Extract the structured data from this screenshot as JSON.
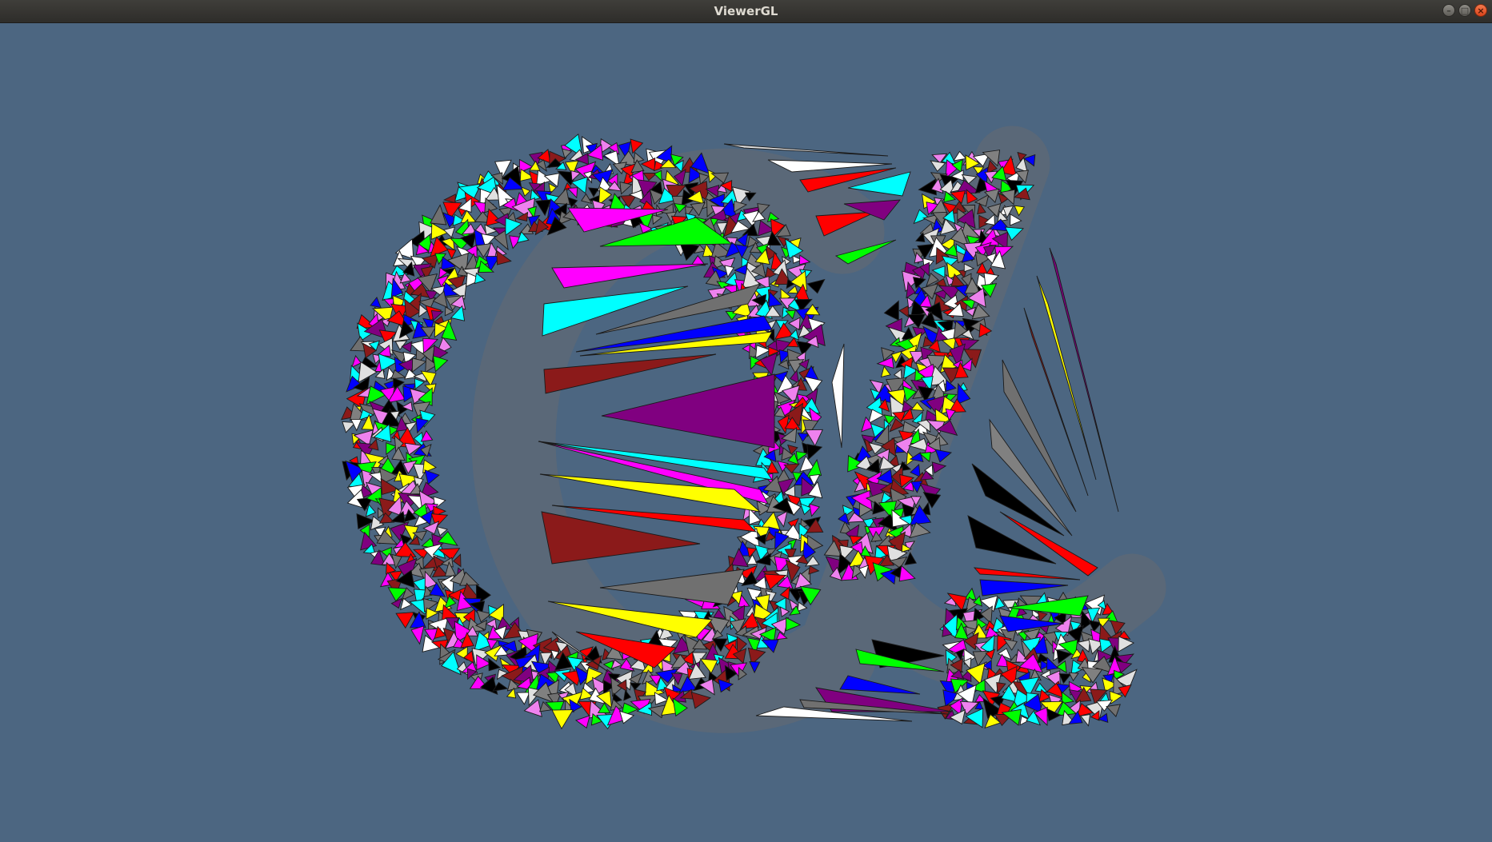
{
  "window": {
    "title": "ViewerGL",
    "controls": [
      {
        "name": "minimize-icon",
        "glyph": "–"
      },
      {
        "name": "maximize-icon",
        "glyph": "□"
      },
      {
        "name": "close-icon",
        "glyph": "×"
      }
    ]
  },
  "viewport": {
    "background": "#4c6681",
    "mesh_edge_color": "#1a1a1a",
    "mesh_backdrop": "#5a6878",
    "palette": [
      "#ff0000",
      "#00ff00",
      "#0000ff",
      "#ffff00",
      "#ff00ff",
      "#00ffff",
      "#800080",
      "#8b1a1a",
      "#000000",
      "#ffffff",
      "#808080",
      "#ee82ee",
      "#707070",
      "#e0e0e0"
    ]
  }
}
